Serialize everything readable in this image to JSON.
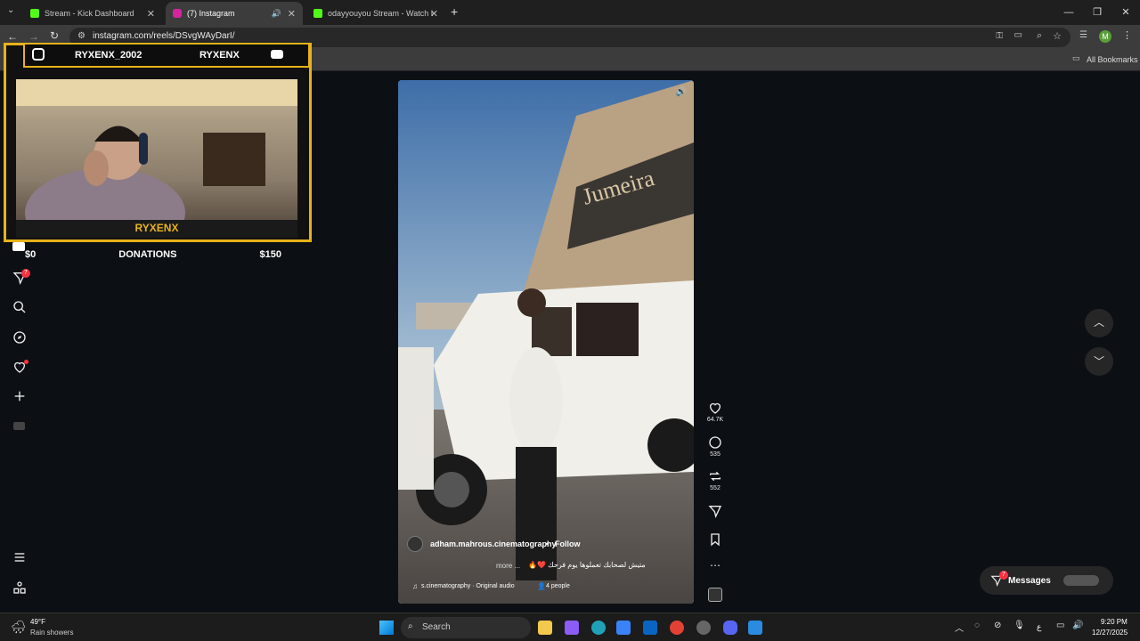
{
  "browser": {
    "tabs": [
      {
        "label": "Stream - Kick Dashboard",
        "favicon_color": "#53fc18"
      },
      {
        "label": "(7) Instagram",
        "favicon_color": "#d6249f"
      },
      {
        "label": "odayyouyou Stream - Watch Li",
        "favicon_color": "#53fc18"
      }
    ],
    "new_tab": "+",
    "url": "instagram.com/reels/DSvgWAyDarI/",
    "bookmarks_label": "All Bookmarks",
    "profile_initial": "M"
  },
  "overlay": {
    "instagram_handle": "RYXENX_2002",
    "youtube_handle": "RYXENX",
    "cam_name": "RYXENX",
    "donations_left": "$0",
    "donations_label": "DONATIONS",
    "donations_right": "$150",
    "accent": "#e7b21a"
  },
  "instagram": {
    "notification_badge": "7",
    "reel": {
      "username": "adham.mahrous.cinematography",
      "follow_label": "Follow",
      "separator": "•",
      "caption": "متيش لصحابك تعملوها يوم فرحك ❤️🔥",
      "more_label": "more ...",
      "audio": "s.cinematography · Original audio",
      "people": "4 people",
      "likes": "64.7K",
      "comments": "535",
      "reposts": "552"
    },
    "messages_label": "Messages",
    "messages_badge": "7"
  },
  "taskbar": {
    "weather_temp": "49°F",
    "weather_desc": "Rain showers",
    "search_label": "Search",
    "time": "9:20 PM",
    "date": "12/27/2025",
    "lang": "ع"
  }
}
